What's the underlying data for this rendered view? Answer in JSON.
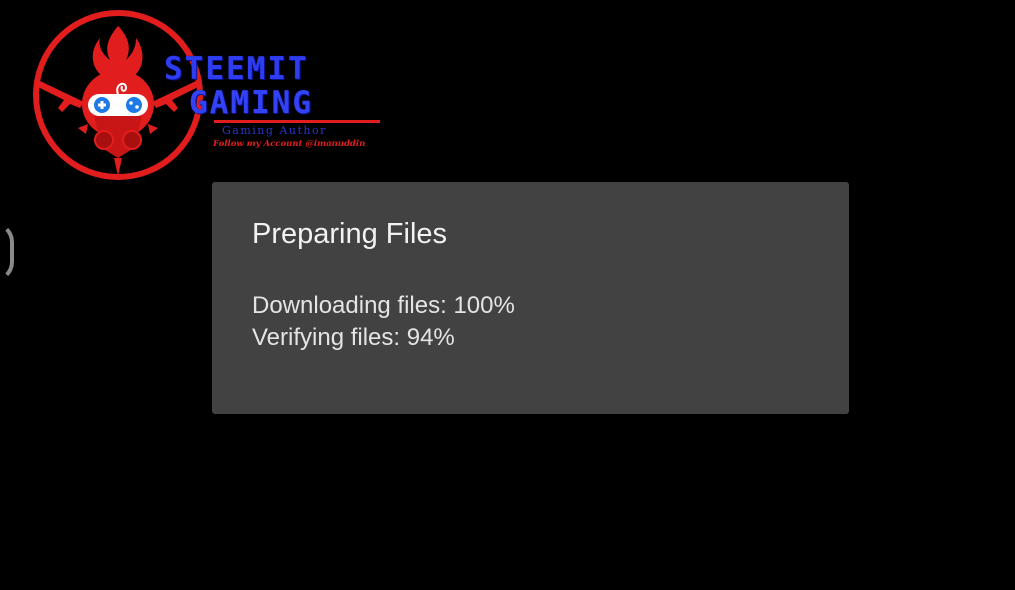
{
  "watermark": {
    "line1": "STEEMIT",
    "line2": "GAMING",
    "subtitle": "Gaming Author",
    "follow": "Follow my Account @imanuddin"
  },
  "dialog": {
    "title": "Preparing Files",
    "status_lines": [
      "Downloading files: 100%",
      "Verifying files: 94%"
    ]
  },
  "progress": {
    "downloading_percent": 100,
    "verifying_percent": 94
  },
  "colors": {
    "background": "#000000",
    "dialog_background": "#424242",
    "dialog_text": "#e4e4e4",
    "logo_red": "#e11d1d",
    "logo_blue": "#2e3df0"
  },
  "icons": {
    "logo_emblem": "gas-mask-gamepad-emblem",
    "edge_fragment": "spinner-arc-icon"
  }
}
